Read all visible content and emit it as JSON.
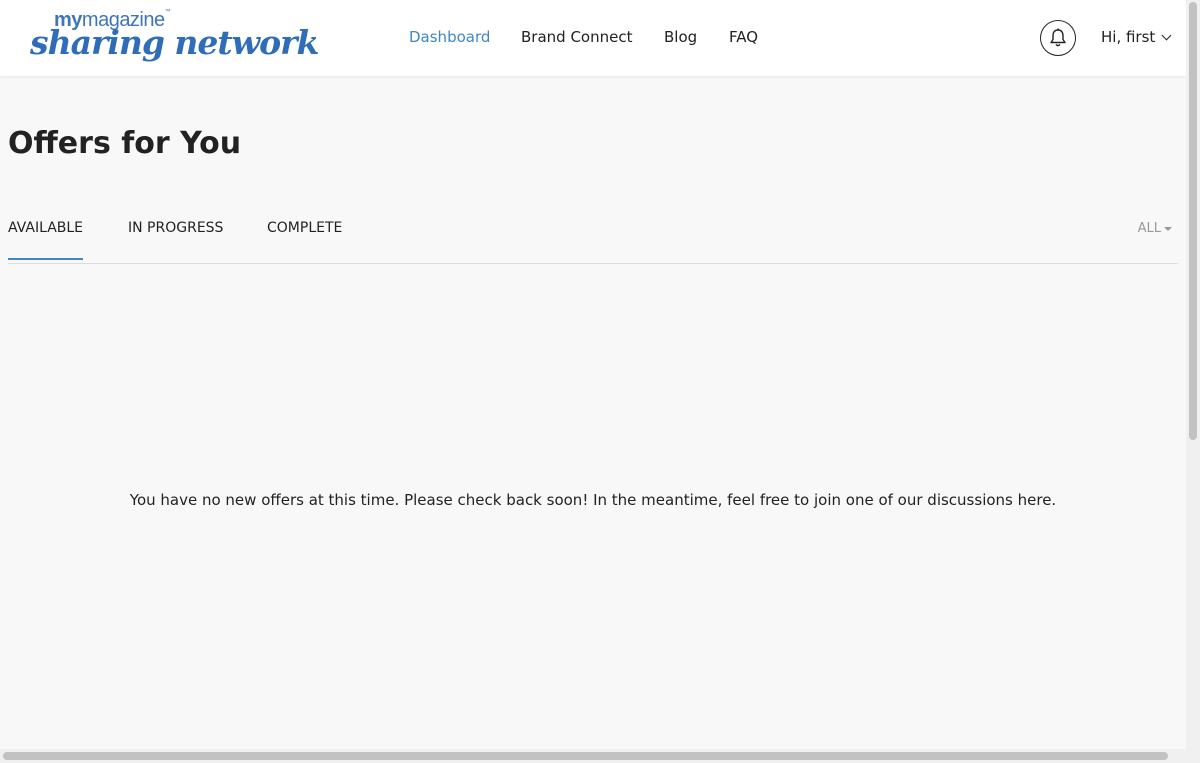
{
  "brand": {
    "logo_top_bold": "my",
    "logo_top_light": "magazine",
    "logo_top_tm": "™",
    "logo_script": "sharing network",
    "accent_color": "#3f86c9"
  },
  "nav": {
    "items": [
      {
        "label": "Dashboard",
        "active": true
      },
      {
        "label": "Brand Connect",
        "active": false
      },
      {
        "label": "Blog",
        "active": false
      },
      {
        "label": "FAQ",
        "active": false
      }
    ]
  },
  "header": {
    "notification_icon": "bell-icon",
    "user_greeting": "Hi, first",
    "user_menu_icon": "chevron-down-icon"
  },
  "main": {
    "title": "Offers for You",
    "tabs": [
      {
        "label": "AVAILABLE",
        "active": true
      },
      {
        "label": "IN PROGRESS",
        "active": false
      },
      {
        "label": "COMPLETE",
        "active": false
      }
    ],
    "filter": {
      "selected": "ALL"
    },
    "empty_message": "You have no new offers at this time. Please check back soon! In the meantime, feel free to join one of our discussions here."
  }
}
